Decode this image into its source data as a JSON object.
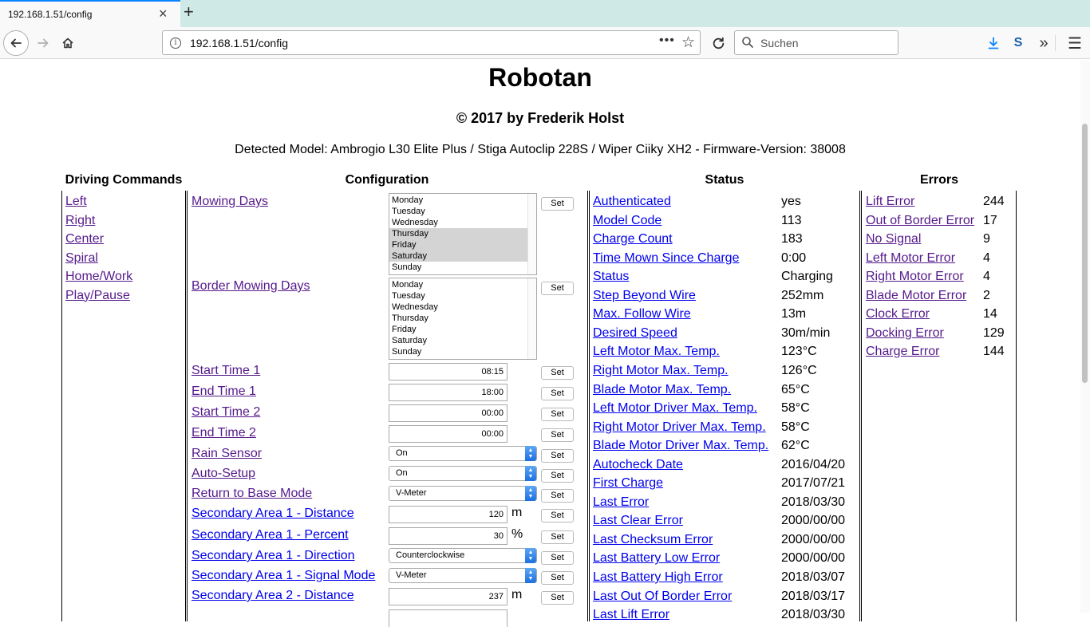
{
  "browser": {
    "tab_title": "192.168.1.51/config",
    "tab_close": "×",
    "new_tab": "+",
    "url": "192.168.1.51/config",
    "url_more": "•••",
    "search_placeholder": "Suchen"
  },
  "page": {
    "title": "Robotan",
    "copyright": "© 2017 by Frederik Holst",
    "model_line": "Detected Model: Ambrogio L30 Elite Plus / Stiga Autoclip 228S / Wiper Ciiky XH2 - Firmware-Version: 38008"
  },
  "headers": {
    "driving": "Driving Commands",
    "configuration": "Configuration",
    "status": "Status",
    "errors": "Errors"
  },
  "driving_commands": [
    "Left",
    "Right",
    "Center",
    "Spiral",
    "Home/Work",
    "Play/Pause"
  ],
  "configuration": {
    "set_label": "Set",
    "mowing_days_label": "Mowing Days",
    "border_mowing_days_label": "Border Mowing Days",
    "days": [
      "Monday",
      "Tuesday",
      "Wednesday",
      "Thursday",
      "Friday",
      "Saturday",
      "Sunday"
    ],
    "mowing_days_selected": [
      "Thursday",
      "Friday",
      "Saturday"
    ],
    "start_time_1": {
      "label": "Start Time 1",
      "value": "08:15"
    },
    "end_time_1": {
      "label": "End Time 1",
      "value": "18:00"
    },
    "start_time_2": {
      "label": "Start Time 2",
      "value": "00:00"
    },
    "end_time_2": {
      "label": "End Time 2",
      "value": "00:00"
    },
    "rain_sensor": {
      "label": "Rain Sensor",
      "value": "On"
    },
    "auto_setup": {
      "label": "Auto-Setup",
      "value": "On"
    },
    "return_base_mode": {
      "label": "Return to Base Mode",
      "value": "V-Meter"
    },
    "sa1_distance": {
      "label": "Secondary Area 1 - Distance",
      "value": "120",
      "unit": "m"
    },
    "sa1_percent": {
      "label": "Secondary Area 1 - Percent",
      "value": "30",
      "unit": "%"
    },
    "sa1_direction": {
      "label": "Secondary Area 1 - Direction",
      "value": "Counterclockwise"
    },
    "sa1_signal_mode": {
      "label": "Secondary Area 1 - Signal Mode",
      "value": "V-Meter"
    },
    "sa2_distance": {
      "label": "Secondary Area 2 - Distance",
      "value": "237",
      "unit": "m"
    }
  },
  "status": [
    {
      "label": "Authenticated",
      "value": "yes"
    },
    {
      "label": "Model Code",
      "value": "113"
    },
    {
      "label": "Charge Count",
      "value": "183"
    },
    {
      "label": "Time Mown Since Charge",
      "value": "0:00"
    },
    {
      "label": "Status",
      "value": "Charging"
    },
    {
      "label": "Step Beyond Wire",
      "value": "252mm"
    },
    {
      "label": "Max. Follow Wire",
      "value": "13m"
    },
    {
      "label": "Desired Speed",
      "value": "30m/min"
    },
    {
      "label": "Left Motor Max. Temp.",
      "value": "123°C"
    },
    {
      "label": "Right Motor Max. Temp.",
      "value": "126°C"
    },
    {
      "label": "Blade Motor Max. Temp.",
      "value": "65°C"
    },
    {
      "label": "Left Motor Driver Max. Temp.",
      "value": "58°C"
    },
    {
      "label": "Right Motor Driver Max. Temp.",
      "value": "58°C"
    },
    {
      "label": "Blade Motor Driver Max. Temp.",
      "value": "62°C"
    },
    {
      "label": "Autocheck Date",
      "value": "2016/04/20"
    },
    {
      "label": "First Charge",
      "value": "2017/07/21"
    },
    {
      "label": "Last Error",
      "value": "2018/03/30"
    },
    {
      "label": "Last Clear Error",
      "value": "2000/00/00"
    },
    {
      "label": "Last Checksum Error",
      "value": "2000/00/00"
    },
    {
      "label": "Last Battery Low Error",
      "value": "2000/00/00"
    },
    {
      "label": "Last Battery High Error",
      "value": "2018/03/07"
    },
    {
      "label": "Last Out Of Border Error",
      "value": "2018/03/17"
    },
    {
      "label": "Last Lift Error",
      "value": "2018/03/30"
    }
  ],
  "errors": [
    {
      "label": "Lift Error",
      "value": "244"
    },
    {
      "label": "Out of Border Error",
      "value": "17"
    },
    {
      "label": "No Signal",
      "value": "9"
    },
    {
      "label": "Left Motor Error",
      "value": "4"
    },
    {
      "label": "Right Motor Error",
      "value": "4"
    },
    {
      "label": "Blade Motor Error",
      "value": "2"
    },
    {
      "label": "Clock Error",
      "value": "14"
    },
    {
      "label": "Docking Error",
      "value": "129"
    },
    {
      "label": "Charge Error",
      "value": "144"
    }
  ],
  "colors": {
    "link": "#0000ee",
    "visited_link": "#551a8b",
    "tabbar": "#cfe9e6",
    "tab_accent": "#0a84ff"
  }
}
